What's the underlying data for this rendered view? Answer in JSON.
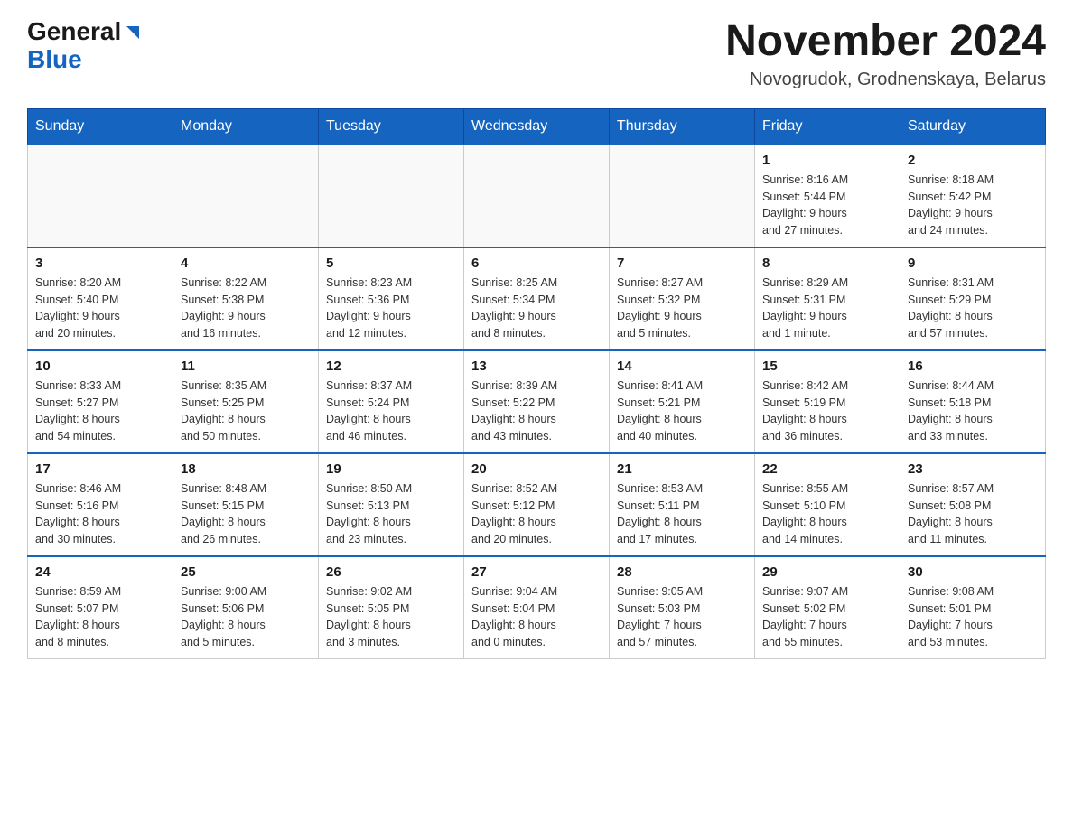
{
  "logo": {
    "general": "General",
    "blue": "Blue",
    "aria": "GeneralBlue logo"
  },
  "header": {
    "month_title": "November 2024",
    "location": "Novogrudok, Grodnenskaya, Belarus"
  },
  "weekdays": [
    "Sunday",
    "Monday",
    "Tuesday",
    "Wednesday",
    "Thursday",
    "Friday",
    "Saturday"
  ],
  "weeks": [
    [
      {
        "day": "",
        "info": ""
      },
      {
        "day": "",
        "info": ""
      },
      {
        "day": "",
        "info": ""
      },
      {
        "day": "",
        "info": ""
      },
      {
        "day": "",
        "info": ""
      },
      {
        "day": "1",
        "info": "Sunrise: 8:16 AM\nSunset: 5:44 PM\nDaylight: 9 hours\nand 27 minutes."
      },
      {
        "day": "2",
        "info": "Sunrise: 8:18 AM\nSunset: 5:42 PM\nDaylight: 9 hours\nand 24 minutes."
      }
    ],
    [
      {
        "day": "3",
        "info": "Sunrise: 8:20 AM\nSunset: 5:40 PM\nDaylight: 9 hours\nand 20 minutes."
      },
      {
        "day": "4",
        "info": "Sunrise: 8:22 AM\nSunset: 5:38 PM\nDaylight: 9 hours\nand 16 minutes."
      },
      {
        "day": "5",
        "info": "Sunrise: 8:23 AM\nSunset: 5:36 PM\nDaylight: 9 hours\nand 12 minutes."
      },
      {
        "day": "6",
        "info": "Sunrise: 8:25 AM\nSunset: 5:34 PM\nDaylight: 9 hours\nand 8 minutes."
      },
      {
        "day": "7",
        "info": "Sunrise: 8:27 AM\nSunset: 5:32 PM\nDaylight: 9 hours\nand 5 minutes."
      },
      {
        "day": "8",
        "info": "Sunrise: 8:29 AM\nSunset: 5:31 PM\nDaylight: 9 hours\nand 1 minute."
      },
      {
        "day": "9",
        "info": "Sunrise: 8:31 AM\nSunset: 5:29 PM\nDaylight: 8 hours\nand 57 minutes."
      }
    ],
    [
      {
        "day": "10",
        "info": "Sunrise: 8:33 AM\nSunset: 5:27 PM\nDaylight: 8 hours\nand 54 minutes."
      },
      {
        "day": "11",
        "info": "Sunrise: 8:35 AM\nSunset: 5:25 PM\nDaylight: 8 hours\nand 50 minutes."
      },
      {
        "day": "12",
        "info": "Sunrise: 8:37 AM\nSunset: 5:24 PM\nDaylight: 8 hours\nand 46 minutes."
      },
      {
        "day": "13",
        "info": "Sunrise: 8:39 AM\nSunset: 5:22 PM\nDaylight: 8 hours\nand 43 minutes."
      },
      {
        "day": "14",
        "info": "Sunrise: 8:41 AM\nSunset: 5:21 PM\nDaylight: 8 hours\nand 40 minutes."
      },
      {
        "day": "15",
        "info": "Sunrise: 8:42 AM\nSunset: 5:19 PM\nDaylight: 8 hours\nand 36 minutes."
      },
      {
        "day": "16",
        "info": "Sunrise: 8:44 AM\nSunset: 5:18 PM\nDaylight: 8 hours\nand 33 minutes."
      }
    ],
    [
      {
        "day": "17",
        "info": "Sunrise: 8:46 AM\nSunset: 5:16 PM\nDaylight: 8 hours\nand 30 minutes."
      },
      {
        "day": "18",
        "info": "Sunrise: 8:48 AM\nSunset: 5:15 PM\nDaylight: 8 hours\nand 26 minutes."
      },
      {
        "day": "19",
        "info": "Sunrise: 8:50 AM\nSunset: 5:13 PM\nDaylight: 8 hours\nand 23 minutes."
      },
      {
        "day": "20",
        "info": "Sunrise: 8:52 AM\nSunset: 5:12 PM\nDaylight: 8 hours\nand 20 minutes."
      },
      {
        "day": "21",
        "info": "Sunrise: 8:53 AM\nSunset: 5:11 PM\nDaylight: 8 hours\nand 17 minutes."
      },
      {
        "day": "22",
        "info": "Sunrise: 8:55 AM\nSunset: 5:10 PM\nDaylight: 8 hours\nand 14 minutes."
      },
      {
        "day": "23",
        "info": "Sunrise: 8:57 AM\nSunset: 5:08 PM\nDaylight: 8 hours\nand 11 minutes."
      }
    ],
    [
      {
        "day": "24",
        "info": "Sunrise: 8:59 AM\nSunset: 5:07 PM\nDaylight: 8 hours\nand 8 minutes."
      },
      {
        "day": "25",
        "info": "Sunrise: 9:00 AM\nSunset: 5:06 PM\nDaylight: 8 hours\nand 5 minutes."
      },
      {
        "day": "26",
        "info": "Sunrise: 9:02 AM\nSunset: 5:05 PM\nDaylight: 8 hours\nand 3 minutes."
      },
      {
        "day": "27",
        "info": "Sunrise: 9:04 AM\nSunset: 5:04 PM\nDaylight: 8 hours\nand 0 minutes."
      },
      {
        "day": "28",
        "info": "Sunrise: 9:05 AM\nSunset: 5:03 PM\nDaylight: 7 hours\nand 57 minutes."
      },
      {
        "day": "29",
        "info": "Sunrise: 9:07 AM\nSunset: 5:02 PM\nDaylight: 7 hours\nand 55 minutes."
      },
      {
        "day": "30",
        "info": "Sunrise: 9:08 AM\nSunset: 5:01 PM\nDaylight: 7 hours\nand 53 minutes."
      }
    ]
  ]
}
